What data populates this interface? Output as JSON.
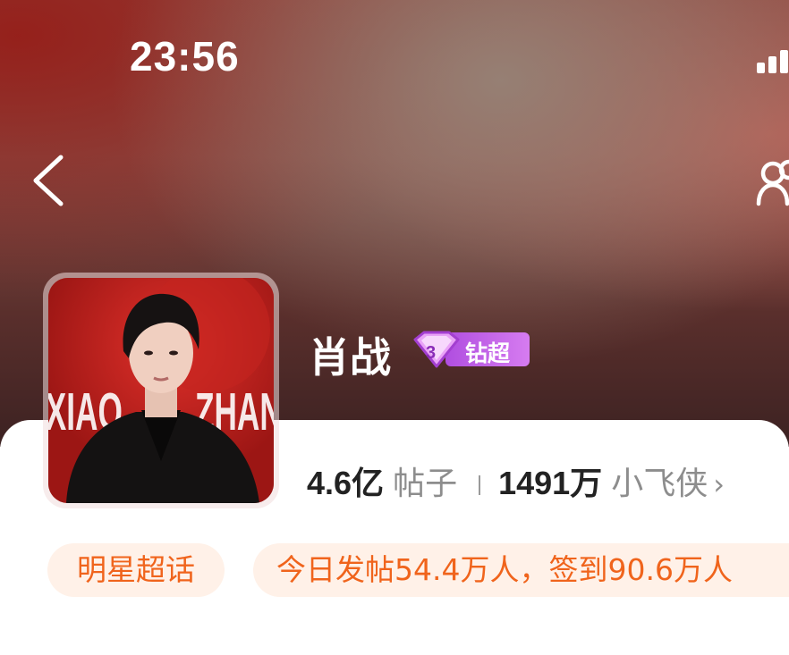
{
  "status_bar": {
    "time": "23:56"
  },
  "header": {
    "back_icon": "chevron-left-icon",
    "group_icon": "group-people-icon"
  },
  "topic": {
    "name": "肖战",
    "badge_label": "钻超",
    "badge_icon": "diamond-icon",
    "avatar_text_left": "XIAO",
    "avatar_text_right": "ZHAN"
  },
  "stats": {
    "posts_value": "4.6",
    "posts_unit": "亿",
    "posts_label": "帖子",
    "followers_value": "1491",
    "followers_unit": "万",
    "followers_label": "小飞侠",
    "chevron": "›"
  },
  "tags": {
    "category": "明星超话",
    "activity": "今日发帖54.4万人，签到90.6万人"
  },
  "colors": {
    "accent_orange": "#f0641c",
    "tag_background": "#fff1e8",
    "badge_purple": "#c060e8"
  }
}
